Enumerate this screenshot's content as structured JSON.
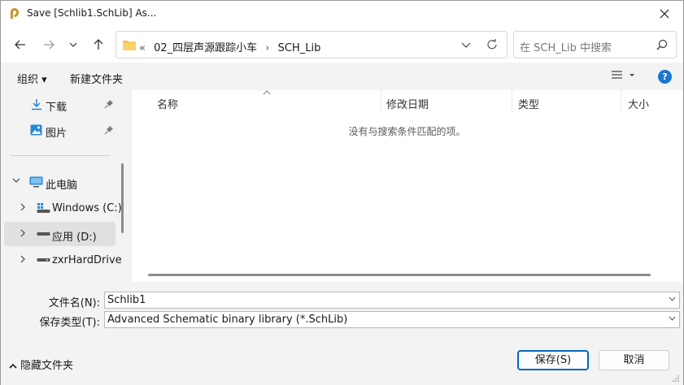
{
  "window": {
    "title": "Save [Schlib1.SchLib] As...",
    "icon": "altium-icon",
    "close_icon": "close-icon"
  },
  "nav": {
    "back_icon": "arrow-left-icon",
    "forward_icon": "arrow-right-icon",
    "recent_icon": "chevron-down-icon",
    "up_icon": "arrow-up-icon",
    "address": {
      "overflow": "«",
      "crumbs": [
        "02_四层声源跟踪小车",
        "SCH_Lib"
      ],
      "separator": "›"
    },
    "search_placeholder": "在 SCH_Lib 中搜索"
  },
  "toolbar": {
    "organize_label": "组织 ▾",
    "new_folder_label": "新建文件夹",
    "view_icon": "list-view-icon",
    "help_label": "?"
  },
  "sidebar": {
    "items": [
      {
        "label": "下载",
        "icon": "download-icon",
        "pinned": true
      },
      {
        "label": "图片",
        "icon": "pictures-icon",
        "pinned": true
      },
      {
        "label": "此电脑",
        "icon": "computer-icon",
        "expanded": true
      },
      {
        "label": "Windows (C:)",
        "icon": "drive-c-icon"
      },
      {
        "label": "应用 (D:)",
        "icon": "drive-icon",
        "selected": true
      },
      {
        "label": "zxrHardDrive",
        "icon": "drive-icon"
      }
    ]
  },
  "filelist": {
    "columns": [
      "名称",
      "修改日期",
      "类型",
      "大小"
    ],
    "empty_message": "没有与搜索条件匹配的项。"
  },
  "form": {
    "filename_label": "文件名(N):",
    "filename_value": "Schlib1",
    "filetype_label": "保存类型(T):",
    "filetype_value": "Advanced Schematic binary library (*.SchLib)"
  },
  "footer": {
    "hide_folders_label": "隐藏文件夹",
    "save_label": "保存(S)",
    "cancel_label": "取消"
  },
  "colors": {
    "accent": "#0067c0",
    "folder": "#f4c24d",
    "help": "#1976d2"
  }
}
